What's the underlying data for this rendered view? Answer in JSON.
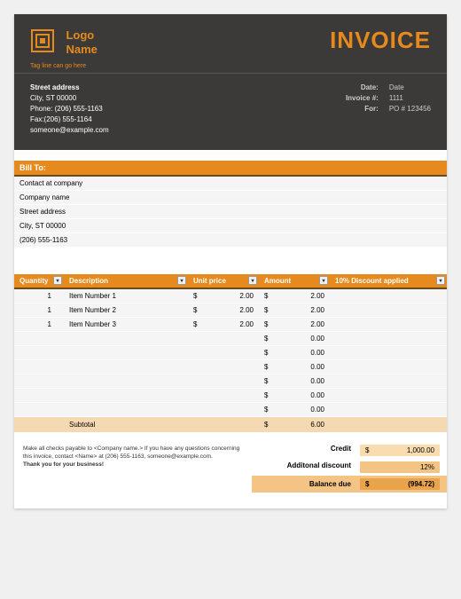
{
  "header": {
    "logo_name_1": "Logo",
    "logo_name_2": "Name",
    "tagline": "Tag line can go here",
    "title": "INVOICE",
    "address": {
      "street": "Street address",
      "city": "City, ST  00000",
      "phone": "Phone: (206) 555-1163",
      "fax": "Fax:(206) 555-1164",
      "email": "someone@example.com"
    },
    "meta_labels": {
      "date": "Date:",
      "invoice": "Invoice #:",
      "for": "For:"
    },
    "meta_values": {
      "date": "Date",
      "invoice": "1111",
      "for": "PO # 123456"
    }
  },
  "billto": {
    "header": "Bill To:",
    "rows": [
      "Contact at company",
      "Company name",
      "Street address",
      "City, ST  00000",
      "(206) 555-1163"
    ]
  },
  "columns": {
    "qty": "Quantity",
    "desc": "Description",
    "price": "Unit price",
    "amount": "Amount",
    "disc": "10% Discount applied"
  },
  "items": [
    {
      "qty": "1",
      "desc": "Item Number 1",
      "price": "2.00",
      "amount": "2.00",
      "disc": ""
    },
    {
      "qty": "1",
      "desc": "Item Number 2",
      "price": "2.00",
      "amount": "2.00",
      "disc": ""
    },
    {
      "qty": "1",
      "desc": "Item Number 3",
      "price": "2.00",
      "amount": "2.00",
      "disc": ""
    },
    {
      "qty": "",
      "desc": "",
      "price": "",
      "amount": "0.00",
      "disc": ""
    },
    {
      "qty": "",
      "desc": "",
      "price": "",
      "amount": "0.00",
      "disc": ""
    },
    {
      "qty": "",
      "desc": "",
      "price": "",
      "amount": "0.00",
      "disc": ""
    },
    {
      "qty": "",
      "desc": "",
      "price": "",
      "amount": "0.00",
      "disc": ""
    },
    {
      "qty": "",
      "desc": "",
      "price": "",
      "amount": "0.00",
      "disc": ""
    },
    {
      "qty": "",
      "desc": "",
      "price": "",
      "amount": "0.00",
      "disc": ""
    }
  ],
  "subtotal": {
    "label": "Subtotal",
    "amount": "6.00"
  },
  "notes": {
    "line1": "Make all checks payable to <Company name.> If you have any questions concerning this invoice, contact <Name> at (206) 555-1163, someone@example.com.",
    "thanks": "Thank you for your business!"
  },
  "totals": {
    "credit_label": "Credit",
    "credit_value": "1,000.00",
    "discount_label": "Additonal discount",
    "discount_value": "12%",
    "balance_label": "Balance due",
    "balance_value": "(994.72)"
  }
}
